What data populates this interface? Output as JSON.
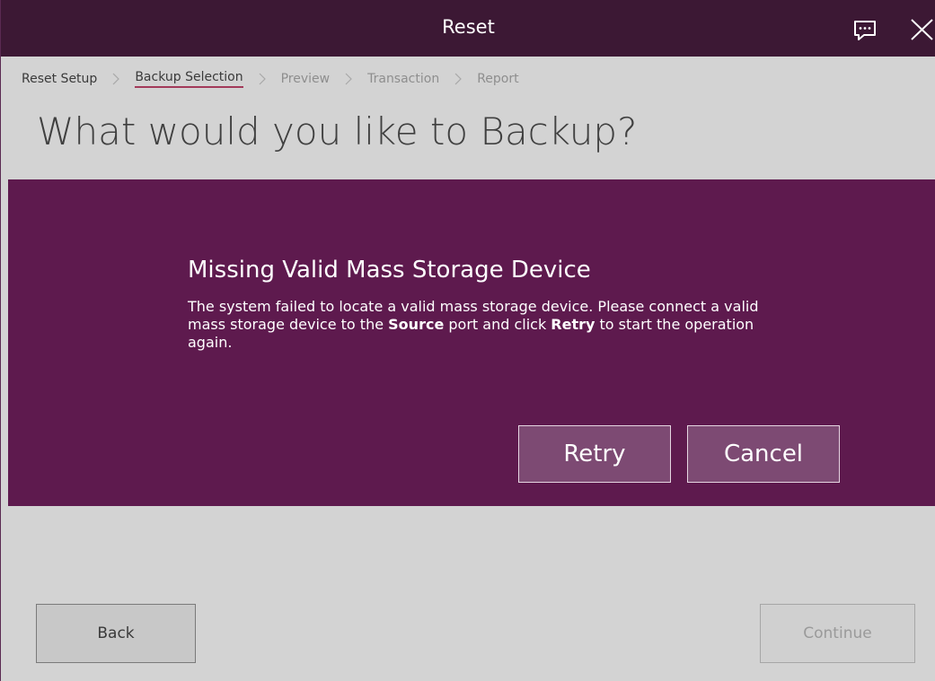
{
  "titlebar": {
    "title": "Reset",
    "feedback_icon": "chat-feedback-icon",
    "close_icon": "close-icon"
  },
  "breadcrumb": {
    "steps": [
      {
        "label": "Reset Setup",
        "state": "completed"
      },
      {
        "label": "Backup Selection",
        "state": "active"
      },
      {
        "label": "Preview",
        "state": "disabled"
      },
      {
        "label": "Transaction",
        "state": "disabled"
      },
      {
        "label": "Report",
        "state": "disabled"
      }
    ],
    "separator_icon": "chevron-right-icon"
  },
  "page": {
    "title": "What would you like to Backup?"
  },
  "dialog": {
    "title": "Missing Valid Mass Storage Device",
    "body_part1": "The system failed to locate a valid mass storage device. Please connect a valid mass storage device to the ",
    "body_bold1": "Source",
    "body_part2": " port and click ",
    "body_bold2": "Retry",
    "body_part3": " to start the operation again.",
    "retry_label": "Retry",
    "cancel_label": "Cancel"
  },
  "footer": {
    "back_label": "Back",
    "continue_label": "Continue"
  },
  "colors": {
    "titlebar_bg": "#3c1834",
    "dialog_bg": "#5e1a4e",
    "dialog_button_bg": "#7d4a73",
    "page_bg": "#d3d3d3",
    "active_underline": "#a33a5a"
  }
}
